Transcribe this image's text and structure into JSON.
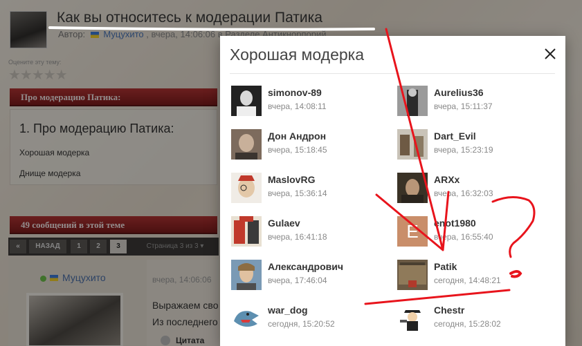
{
  "topic": {
    "title": "Как вы относитесь к модерации Патика",
    "author_label": "Автор:",
    "author_name": "Муцухито",
    "meta_rest": ", вчера, 14:06:06 в Разделе Антикнорпорий"
  },
  "rating": {
    "label": "Оцените эту тему:",
    "stars": "★★★★★"
  },
  "poll": {
    "header": "Про модерацию Патика:",
    "question": "1. Про модерацию Патика:",
    "options": [
      "Хорошая модерка",
      "Днище модерка"
    ]
  },
  "thread": {
    "header": "49 сообщений в этой теме"
  },
  "pagination": {
    "prev": "«",
    "back_label": "НАЗАД",
    "pages": [
      "1",
      "2",
      "3"
    ],
    "current": "3",
    "page_of": "Страница 3 из 3 ▾"
  },
  "post": {
    "author": "Муцухито",
    "time": "вчера, 14:06:06",
    "text_line1": "Выражаем сво",
    "text_line2": "Из последнего",
    "quote_label": "Цитата"
  },
  "modal": {
    "title": "Хорошая модерка",
    "close_icon": "close-icon",
    "voters": [
      {
        "name": "simonov-89",
        "time": "вчера, 14:08:11"
      },
      {
        "name": "Aurelius36",
        "time": "вчера, 15:11:37"
      },
      {
        "name": "Дон Андрон",
        "time": "вчера, 15:18:45"
      },
      {
        "name": "Dart_Evil",
        "time": "вчера, 15:23:19"
      },
      {
        "name": "MaslovRG",
        "time": "вчера, 15:36:14"
      },
      {
        "name": "ARXx",
        "time": "вчера, 16:32:03"
      },
      {
        "name": "Gulaev",
        "time": "вчера, 16:41:18"
      },
      {
        "name": "enot1980",
        "time": "вчера, 16:55:40",
        "avatar_letter": "E"
      },
      {
        "name": "Александрович",
        "time": "вчера, 17:46:04"
      },
      {
        "name": "Patik",
        "time": "сегодня, 14:48:21"
      },
      {
        "name": "war_dog",
        "time": "сегодня, 15:20:52"
      },
      {
        "name": "Chestr",
        "time": "сегодня, 15:28:02"
      }
    ]
  },
  "colors": {
    "accent_red": "#b23434",
    "annotation_red": "#e8141c",
    "link_blue": "#4a76b8"
  }
}
